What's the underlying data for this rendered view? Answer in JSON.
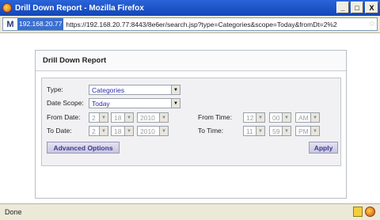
{
  "window": {
    "title": "Drill Down Report - Mozilla Firefox",
    "buttons": {
      "minimize": "_",
      "maximize": "□",
      "close": "X"
    }
  },
  "urlbar": {
    "host": "192.168.20.77",
    "url": "https://192.168.20.77:8443/8e6er/search.jsp?type=Categories&scope=Today&fromDt=2%2"
  },
  "panel": {
    "title": "Drill Down Report",
    "type_label": "Type:",
    "type_value": "Categories",
    "date_scope_label": "Date Scope:",
    "date_scope_value": "Today",
    "from_date_label": "From Date:",
    "from_date": {
      "month": "2",
      "day": "18",
      "year": "2010"
    },
    "to_date_label": "To Date:",
    "to_date": {
      "month": "2",
      "day": "18",
      "year": "2010"
    },
    "from_time_label": "From Time:",
    "from_time": {
      "hour": "12",
      "minute": "00",
      "ampm": "AM"
    },
    "to_time_label": "To Time:",
    "to_time": {
      "hour": "11",
      "minute": "59",
      "ampm": "PM"
    },
    "advanced_button": "Advanced Options",
    "apply_button": "Apply"
  },
  "statusbar": {
    "text": "Done"
  }
}
